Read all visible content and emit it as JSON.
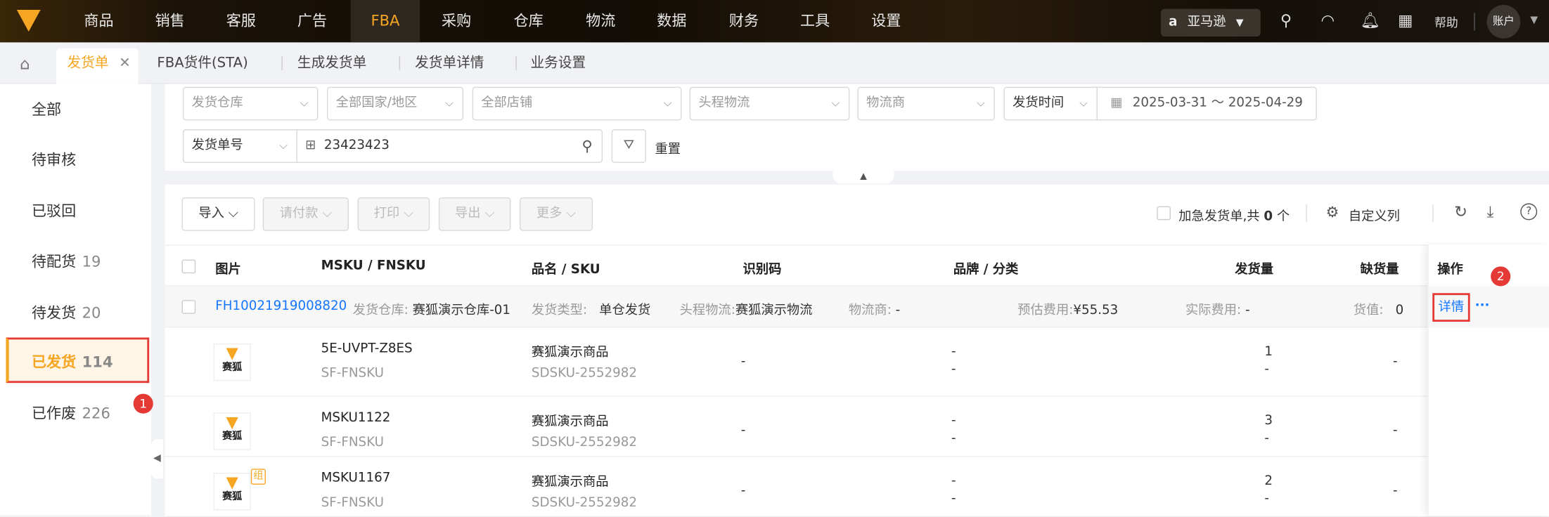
{
  "nav": {
    "items": [
      "商品",
      "销售",
      "客服",
      "广告",
      "FBA",
      "采购",
      "仓库",
      "物流",
      "数据",
      "财务",
      "工具",
      "设置"
    ],
    "active": "FBA",
    "marketplace": "亚马逊",
    "help": "帮助",
    "account": "账户"
  },
  "tabs": {
    "active": "发货单",
    "items": [
      "FBA货件(STA)",
      "生成发货单",
      "发货单详情",
      "业务设置"
    ]
  },
  "sidebar": [
    {
      "label": "全部",
      "count": ""
    },
    {
      "label": "待审核",
      "count": ""
    },
    {
      "label": "已驳回",
      "count": ""
    },
    {
      "label": "待配货",
      "count": "19"
    },
    {
      "label": "待发货",
      "count": "20"
    },
    {
      "label": "已发货",
      "count": "114"
    },
    {
      "label": "已作废",
      "count": "226"
    }
  ],
  "filters": {
    "warehouse": "发货仓库",
    "country": "全部国家/地区",
    "shop": "全部店铺",
    "logistics": "头程物流",
    "carrier": "物流商",
    "time_type": "发货时间",
    "date_range": "2025-03-31 ～ 2025-04-29",
    "search_type": "发货单号",
    "search_value": "23423423",
    "reset": "重置"
  },
  "toolbar": {
    "import": "导入",
    "pay": "请付款",
    "print": "打印",
    "export": "导出",
    "more": "更多",
    "urgent": "加急发货单,共",
    "urgent_count": "0",
    "urgent_unit": "个",
    "custom_cols": "自定义列"
  },
  "table": {
    "headers": [
      "图片",
      "MSKU / FNSKU",
      "品名 / SKU",
      "识别码",
      "品牌 / 分类",
      "发货量",
      "缺货量",
      "操作"
    ],
    "group": {
      "id": "FH10021919008820",
      "wh_label": "发货仓库:",
      "wh": "赛狐演示仓库-01",
      "type_label": "发货类型:",
      "type": "单仓发货",
      "log_label": "头程物流:",
      "log": "赛狐演示物流",
      "carrier_label": "物流商:",
      "carrier": "-",
      "est_label": "预估费用:",
      "est": "¥55.53",
      "act_label": "实际费用:",
      "act": "-",
      "value_label": "货值:",
      "value": "0",
      "detail": "详情",
      "more": "···"
    },
    "rows": [
      {
        "img_text": "赛狐",
        "combo": "",
        "msku": "5E-UVPT-Z8ES",
        "fnsku": "SF-FNSKU",
        "name": "赛狐演示商品",
        "sku": "SDSKU-2552982",
        "code": "-",
        "brand": "-",
        "category": "-",
        "qty": "1",
        "qty2": "-",
        "short": "-"
      },
      {
        "img_text": "赛狐",
        "combo": "",
        "msku": "MSKU1122",
        "fnsku": "SF-FNSKU",
        "name": "赛狐演示商品",
        "sku": "SDSKU-2552982",
        "code": "-",
        "brand": "-",
        "category": "-",
        "qty": "3",
        "qty2": "-",
        "short": "-"
      },
      {
        "img_text": "赛狐",
        "combo": "组",
        "msku": "MSKU1167",
        "fnsku": "SF-FNSKU",
        "name": "赛狐演示商品",
        "sku": "SDSKU-2552982",
        "code": "-",
        "brand": "-",
        "category": "-",
        "qty": "2",
        "qty2": "-",
        "short": "-"
      }
    ]
  },
  "annotations": [
    "1",
    "2"
  ]
}
